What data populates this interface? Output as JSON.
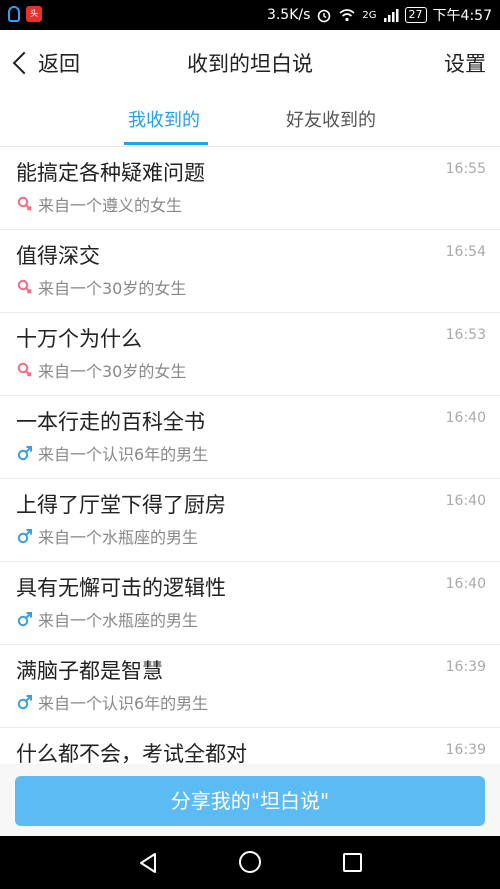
{
  "status_bar": {
    "speed": "3.5K/s",
    "battery": "27",
    "time": "下午4:57",
    "network": "2G"
  },
  "nav": {
    "back_label": "返回",
    "title": "收到的坦白说",
    "settings_label": "设置"
  },
  "tabs": [
    {
      "label": "我收到的",
      "active": true
    },
    {
      "label": "好友收到的",
      "active": false
    }
  ],
  "items": [
    {
      "title": "能搞定各种疑难问题",
      "source": "来自一个遵义的女生",
      "time": "16:55",
      "gender": "female"
    },
    {
      "title": "值得深交",
      "source": "来自一个30岁的女生",
      "time": "16:54",
      "gender": "female"
    },
    {
      "title": "十万个为什么",
      "source": "来自一个30岁的女生",
      "time": "16:53",
      "gender": "female"
    },
    {
      "title": "一本行走的百科全书",
      "source": "来自一个认识6年的男生",
      "time": "16:40",
      "gender": "male"
    },
    {
      "title": "上得了厅堂下得了厨房",
      "source": "来自一个水瓶座的男生",
      "time": "16:40",
      "gender": "male"
    },
    {
      "title": "具有无懈可击的逻辑性",
      "source": "来自一个水瓶座的男生",
      "time": "16:40",
      "gender": "male"
    },
    {
      "title": "满脑子都是智慧",
      "source": "来自一个认识6年的男生",
      "time": "16:39",
      "gender": "male"
    },
    {
      "title": "什么都不会，考试全都对",
      "source": "",
      "time": "16:39",
      "gender": "male"
    }
  ],
  "share_button_label": "分享我的\"坦白说\"",
  "colors": {
    "accent": "#1fa2e8",
    "share_button": "#5cbbf2",
    "female_icon": "#f06b85",
    "male_icon": "#3a9de0"
  }
}
